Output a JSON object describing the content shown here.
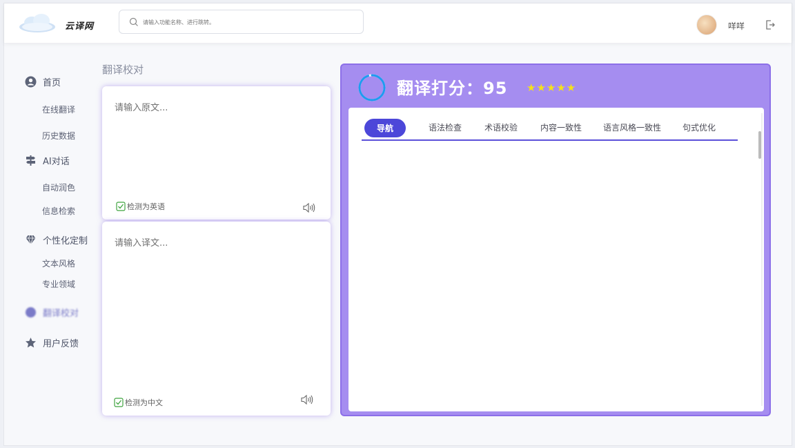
{
  "header": {
    "brand": "云译网",
    "search_placeholder": "请输入功能名称、进行跳转。",
    "username": "咩咩"
  },
  "sidebar": {
    "home": "首页",
    "online_translate": "在线翻译",
    "history": "历史数据",
    "ai_chat": "AI对话",
    "auto_polish": "自动润色",
    "info_search": "信息检索",
    "personalize": "个性化定制",
    "text_style": "文本风格",
    "domain": "专业领域",
    "proofread": "翻译校对",
    "feedback": "用户反馈"
  },
  "main": {
    "title": "翻译校对",
    "source": {
      "placeholder": "请输入原文...",
      "detect": "检测为英语"
    },
    "target": {
      "placeholder": "请输入译文...",
      "detect": "检测为中文"
    }
  },
  "panel": {
    "score_label": "翻译打分：95",
    "score_value": 95,
    "score_max": 100,
    "stars_display": "★★★★★",
    "stars": 5,
    "tabs": [
      "导航",
      "语法检查",
      "术语校验",
      "内容一致性",
      "语言风格一致性",
      "句式优化"
    ],
    "active_tab": 0
  },
  "colors": {
    "panel_bg": "#a58df0",
    "accent": "#4c47d9",
    "star": "#f4e11a",
    "ring": "#1e9bf0",
    "check": "#3fa33f"
  }
}
